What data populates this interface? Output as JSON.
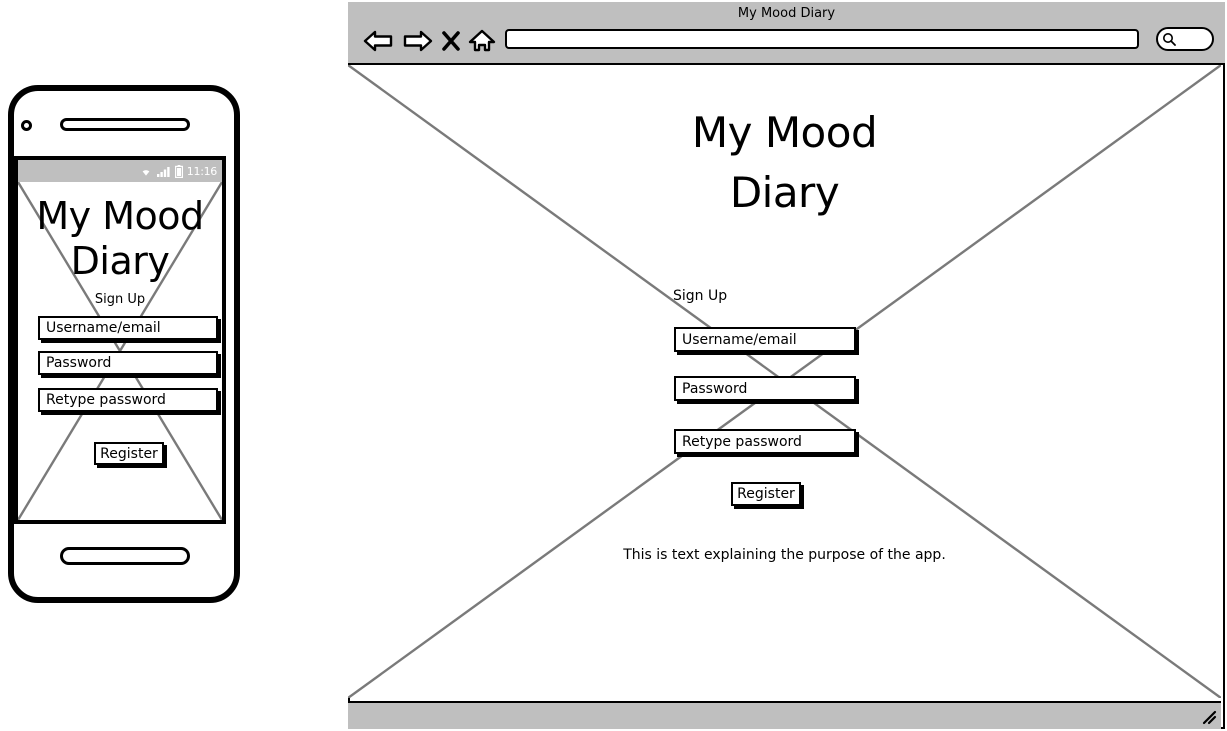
{
  "phone": {
    "status_bar": {
      "time": "11:16",
      "icons": [
        "wifi-icon",
        "signal-bars-icon",
        "battery-icon"
      ]
    },
    "app_title": "My Mood Diary",
    "section_label": "Sign Up",
    "fields": [
      {
        "name": "username-email",
        "value": "Username/email"
      },
      {
        "name": "password",
        "value": "Password"
      },
      {
        "name": "retype-password",
        "value": "Retype password"
      }
    ],
    "register_label": "Register"
  },
  "browser": {
    "window_title": "My Mood Diary",
    "nav_icons": [
      "back-arrow-icon",
      "forward-arrow-icon",
      "stop-x-icon",
      "home-icon"
    ],
    "url_value": "",
    "url_placeholder": "",
    "search_value": "",
    "search_placeholder": "",
    "search_icon": "magnifier-icon",
    "resize_icon": "resize-grip-icon",
    "page": {
      "heading_line1": "My Mood",
      "heading_line2": "Diary",
      "section_label": "Sign Up",
      "fields": [
        {
          "name": "username-email",
          "value": "Username/email"
        },
        {
          "name": "password",
          "value": "Password"
        },
        {
          "name": "retype-password",
          "value": "Retype password"
        }
      ],
      "register_label": "Register",
      "description": "This is text explaining the purpose of the app."
    }
  },
  "colors": {
    "chrome_gray": "#bfbfbf",
    "placeholder_line": "#7a7a7a",
    "outline": "#000000",
    "page_bg": "#ffffff"
  }
}
